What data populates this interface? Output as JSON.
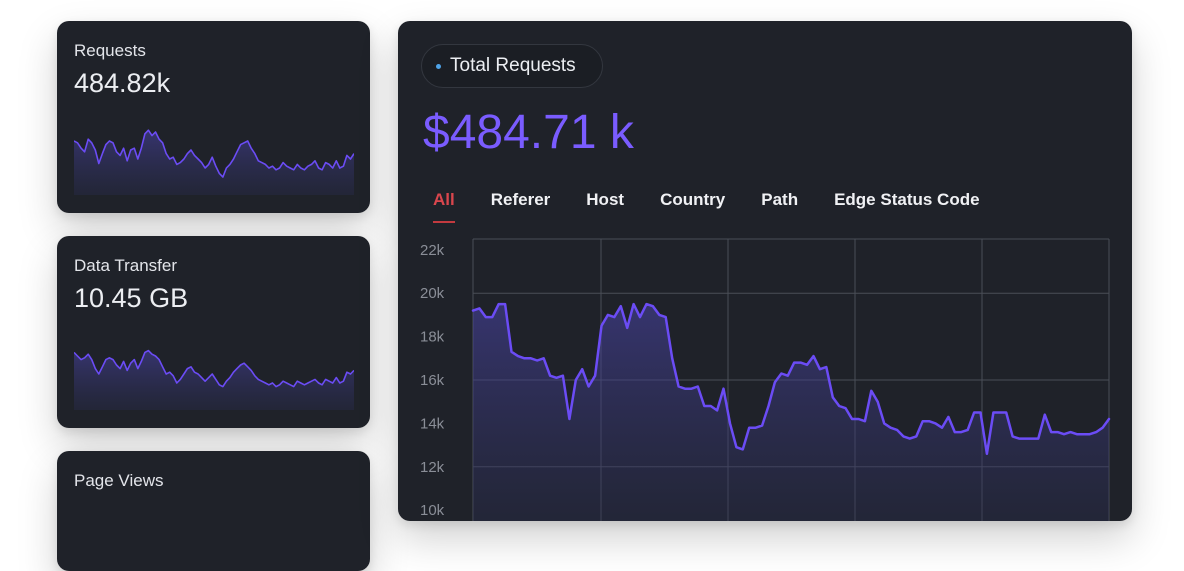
{
  "colors": {
    "card_bg": "#1f2229",
    "line": "#6b4cf5",
    "accent_text": "#7a5cff",
    "active_tab": "#d9464d",
    "pill_dot": "#4ea3e8",
    "grid": "#4a4e57",
    "tick": "#8a8e97"
  },
  "stats": [
    {
      "label": "Requests",
      "value": "484.82k"
    },
    {
      "label": "Data Transfer",
      "value": "10.45 GB"
    },
    {
      "label": "Page Views"
    }
  ],
  "main": {
    "pill_label": "Total Requests",
    "total": "$484.71 k",
    "tabs": [
      "All",
      "Referer",
      "Host",
      "Country",
      "Path",
      "Edge Status Code"
    ],
    "active_tab": 0
  },
  "chart_data": {
    "type": "area",
    "x": [
      1,
      2,
      3,
      4,
      5,
      6,
      7,
      8,
      9,
      10,
      11,
      12,
      13,
      14,
      15,
      16,
      17,
      18,
      19,
      20,
      21,
      22,
      23,
      24,
      25,
      26,
      27,
      28,
      29,
      30,
      31,
      32,
      33,
      34,
      35,
      36,
      37,
      38,
      39,
      40,
      41,
      42,
      43,
      44,
      45,
      46,
      47,
      48,
      49,
      50,
      51,
      52,
      53,
      54,
      55,
      56,
      57,
      58,
      59,
      60,
      61,
      62,
      63,
      64,
      65,
      66,
      67,
      68,
      69,
      70,
      71,
      72,
      73,
      74,
      75,
      76,
      77,
      78,
      79,
      80,
      81,
      82,
      83,
      84,
      85,
      86,
      87,
      88,
      89,
      90,
      91,
      92,
      93,
      94,
      95,
      96,
      97,
      98,
      99,
      100
    ],
    "values": [
      19200,
      19300,
      18900,
      18900,
      19500,
      19500,
      17300,
      17100,
      17000,
      17000,
      16900,
      17000,
      16200,
      16100,
      16200,
      14200,
      16000,
      16500,
      15700,
      16200,
      18500,
      19000,
      18900,
      19400,
      18400,
      19500,
      18900,
      19500,
      19400,
      19000,
      18900,
      17000,
      15700,
      15600,
      15600,
      15700,
      14800,
      14800,
      14600,
      15600,
      14000,
      12900,
      12800,
      13800,
      13800,
      13900,
      14800,
      15900,
      16300,
      16200,
      16800,
      16800,
      16700,
      17100,
      16500,
      16600,
      15200,
      14800,
      14700,
      14200,
      14200,
      14100,
      15500,
      15000,
      14000,
      13800,
      13700,
      13400,
      13300,
      13400,
      14100,
      14100,
      14000,
      13800,
      14300,
      13600,
      13600,
      13700,
      14500,
      14500,
      12600,
      14500,
      14500,
      14500,
      13400,
      13300,
      13300,
      13300,
      13300,
      14400,
      13600,
      13600,
      13500,
      13600,
      13500,
      13500,
      13500,
      13600,
      13800,
      14200
    ],
    "ylim": [
      9500,
      22500
    ],
    "yticks": [
      "22k",
      "20k",
      "18k",
      "16k",
      "14k",
      "12k",
      "10k"
    ],
    "grid": true,
    "sparkline_values": [
      [
        0.6,
        0.58,
        0.52,
        0.48,
        0.62,
        0.58,
        0.5,
        0.35,
        0.46,
        0.56,
        0.6,
        0.58,
        0.48,
        0.44,
        0.52,
        0.38,
        0.5,
        0.52,
        0.4,
        0.52,
        0.68,
        0.72,
        0.66,
        0.7,
        0.62,
        0.58,
        0.46,
        0.4,
        0.42,
        0.34,
        0.36,
        0.4,
        0.46,
        0.5,
        0.44,
        0.4,
        0.36,
        0.3,
        0.34,
        0.42,
        0.32,
        0.24,
        0.2,
        0.3,
        0.34,
        0.4,
        0.48,
        0.56,
        0.58,
        0.6,
        0.52,
        0.46,
        0.38,
        0.36,
        0.34,
        0.3,
        0.32,
        0.28,
        0.3,
        0.36,
        0.32,
        0.3,
        0.28,
        0.34,
        0.3,
        0.28,
        0.32,
        0.34,
        0.38,
        0.3,
        0.28,
        0.36,
        0.34,
        0.3,
        0.38,
        0.3,
        0.32,
        0.44,
        0.4,
        0.46
      ],
      [
        0.64,
        0.6,
        0.56,
        0.58,
        0.62,
        0.56,
        0.46,
        0.4,
        0.48,
        0.56,
        0.58,
        0.56,
        0.5,
        0.46,
        0.54,
        0.44,
        0.52,
        0.56,
        0.46,
        0.54,
        0.64,
        0.66,
        0.62,
        0.6,
        0.56,
        0.48,
        0.4,
        0.42,
        0.38,
        0.3,
        0.34,
        0.4,
        0.46,
        0.48,
        0.42,
        0.4,
        0.36,
        0.32,
        0.36,
        0.4,
        0.34,
        0.28,
        0.26,
        0.32,
        0.36,
        0.42,
        0.46,
        0.5,
        0.52,
        0.48,
        0.44,
        0.38,
        0.34,
        0.32,
        0.3,
        0.28,
        0.3,
        0.26,
        0.28,
        0.32,
        0.3,
        0.28,
        0.26,
        0.32,
        0.3,
        0.28,
        0.3,
        0.32,
        0.34,
        0.3,
        0.28,
        0.34,
        0.32,
        0.3,
        0.36,
        0.3,
        0.32,
        0.42,
        0.4,
        0.44
      ]
    ]
  }
}
